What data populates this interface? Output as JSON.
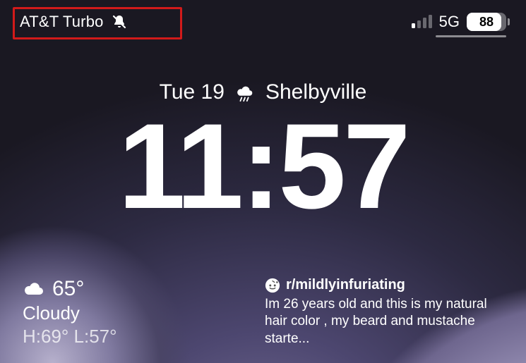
{
  "status": {
    "carrier": "AT&T Turbo",
    "silent": true,
    "signal_bars_active": 1,
    "signal_bars_total": 4,
    "network": "5G",
    "battery_percent": 88
  },
  "date": {
    "weekday_day": "Tue 19",
    "weather_icon": "rain-icon",
    "location": "Shelbyville"
  },
  "clock": {
    "time": "11:57"
  },
  "weather_widget": {
    "icon": "cloud-icon",
    "temp": "65°",
    "condition": "Cloudy",
    "hi_lo": "H:69° L:57°"
  },
  "notification": {
    "app_icon": "reddit-icon",
    "title": "r/mildlyinfuriating",
    "body": "Im 26 years old and this is my natural hair color , my beard and mustache starte..."
  },
  "annotation": {
    "highlight_color": "#d11a1a"
  }
}
